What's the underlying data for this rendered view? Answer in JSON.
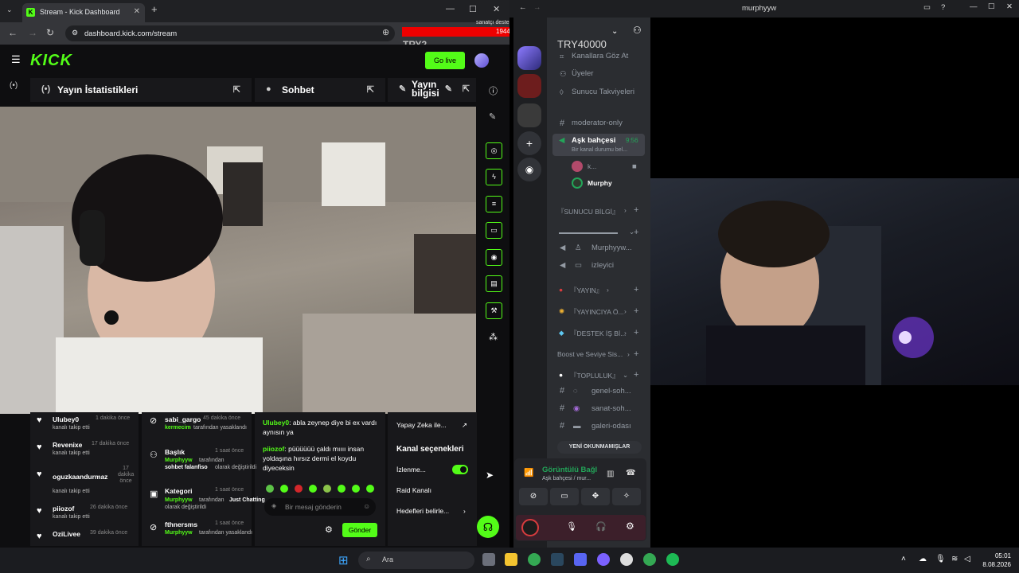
{
  "browser": {
    "tab_title": "Stream - Kick Dashboard",
    "url": "dashboard.kick.com/stream",
    "overlay_top_text": "sanatçı destek",
    "overlay_bar_text": "19446 (4.86%)",
    "overlay_name": "TRY2",
    "overlay_amount": "TRY40000"
  },
  "kick": {
    "logo": "KICK",
    "go_live_label": "Go live",
    "panels": {
      "stats_title": "Yayın İstatistikleri",
      "chat_title": "Sohbet",
      "info_title": "Yayın bilgisi"
    },
    "events_col1": [
      {
        "user": "Ulubey0",
        "action": "kanalı takip etti",
        "time": "1 dakika önce"
      },
      {
        "user": "Revenixe",
        "action": "kanalı takip etti",
        "time": "17 dakika önce"
      },
      {
        "user": "oguzkaandurmaz",
        "action": "kanalı takip etti",
        "time": "17 dakika önce"
      },
      {
        "user": "piiozof",
        "action": "kanalı takip etti",
        "time": "26 dakika önce"
      },
      {
        "user": "OziLivee",
        "action": "",
        "time": "39 dakika önce"
      }
    ],
    "events_col2": [
      {
        "user": "sabi_gargo",
        "time": "45 dakika önce",
        "actor": "kermecim",
        "action": "tarafından yasaklandı"
      },
      {
        "user": "Başlık",
        "time": "1 saat önce",
        "actor": "Murphyyw",
        "action": "tarafından",
        "value": "sohbet falanfiso",
        "suffix": "olarak değiştirildi"
      },
      {
        "user": "Kategori",
        "time": "1 saat önce",
        "actor": "Murphyyw",
        "action": "tarafından",
        "value": "Just Chatting",
        "suffix": "olarak değiştirildi"
      },
      {
        "user": "fthnersms",
        "time": "1 saat önce",
        "actor": "Murphyyw",
        "action": "tarafından yasaklandı"
      }
    ],
    "chat": [
      {
        "user": "Ulubey0",
        "text": "abla zeynep diye bi ex vardı aynısın ya"
      },
      {
        "user": "piiozof",
        "text": "püüüüüü çaldı mıııı insan yoldaşına hırsız dermi el koydu diyeceksin"
      }
    ],
    "chat_placeholder": "Bir mesaj gönderin",
    "send_label": "Gönder",
    "channel": {
      "ai_label": "Yapay Zeka ile...",
      "options_title": "Kanal seçenekleri",
      "watching_label": "İzlenme...",
      "raid_label": "Raid Kanalı",
      "goals_label": "Hedefleri belirle..."
    }
  },
  "discord": {
    "window_title": "murphyyw",
    "menu": [
      "Kanallara Göz At",
      "Üyeler",
      "Sunucu Takviyeleri"
    ],
    "channels": [
      {
        "name": "moderator-only"
      },
      {
        "name": "Aşk bahçesi",
        "time": "9:56",
        "status": "Bir kanal durumu bel..."
      }
    ],
    "voice_users": [
      "k...",
      "Murphy"
    ],
    "categories": [
      "『SUNUCU BİLGİ』",
      "『YAYIN』",
      "『YAYINCIYA Ö...",
      "『DESTEK İŞ Bİ...",
      "Boost ve Seviye Sis...",
      "『TOPLULUK』"
    ],
    "sub_channels": [
      "Murphyyw...",
      "izleyici",
      "genel-soh...",
      "sanat-soh...",
      "galeri-odası"
    ],
    "unread_label": "YENİ OKUNMAMIŞLAR",
    "voice_connected": "Görüntülü Bağl",
    "voice_channel": "Aşk bahçesi / mur..."
  },
  "taskbar": {
    "search_label": "Ara",
    "time": "05:01",
    "date": "8.08.2026"
  },
  "colors": {
    "kick_green": "#53fc18",
    "discord_bg": "#2b2d31",
    "discord_green": "#23a559"
  }
}
